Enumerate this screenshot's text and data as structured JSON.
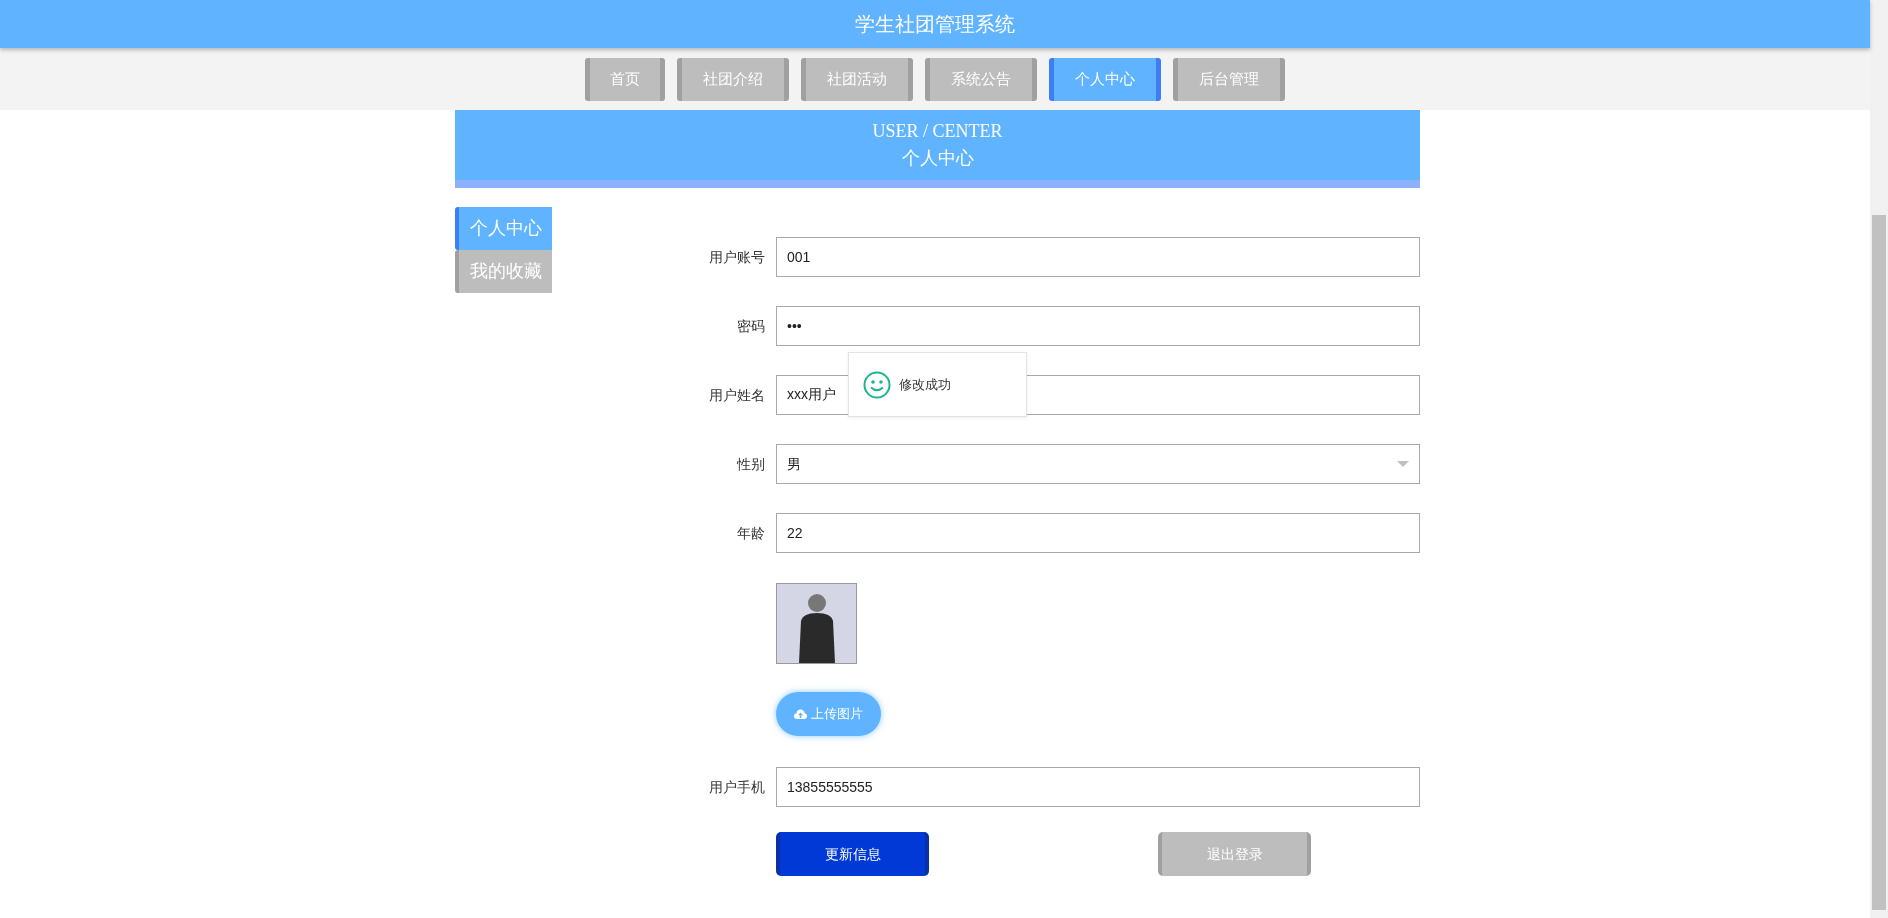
{
  "header": {
    "title": "学生社团管理系统"
  },
  "nav": [
    {
      "label": "首页",
      "selected": false
    },
    {
      "label": "社团介绍",
      "selected": false
    },
    {
      "label": "社团活动",
      "selected": false
    },
    {
      "label": "系统公告",
      "selected": false
    },
    {
      "label": "个人中心",
      "selected": true
    },
    {
      "label": "后台管理",
      "selected": false
    }
  ],
  "banner": {
    "title_en": "USER / CENTER",
    "title_cn": "个人中心"
  },
  "side_tabs": [
    {
      "label": "个人中心",
      "selected": true
    },
    {
      "label": "我的收藏",
      "selected": false
    }
  ],
  "form": [
    {
      "kind": "text",
      "label": "用户账号",
      "value": "001"
    },
    {
      "kind": "text",
      "label": "密码",
      "value": "•••"
    },
    {
      "kind": "text",
      "label": "用户姓名",
      "value": "xxx用户"
    },
    {
      "kind": "select",
      "label": "性别",
      "value": "男"
    },
    {
      "kind": "text",
      "label": "年龄",
      "value": "22"
    },
    {
      "kind": "photo"
    },
    {
      "kind": "upload",
      "label": "上传图片"
    },
    {
      "kind": "text",
      "label": "用户手机",
      "value": "13855555555"
    }
  ],
  "buttons": [
    {
      "kind": "primary",
      "label": "更新信息"
    },
    {
      "kind": "secondary",
      "label": "退出登录"
    }
  ],
  "toast": {
    "message": "修改成功"
  }
}
